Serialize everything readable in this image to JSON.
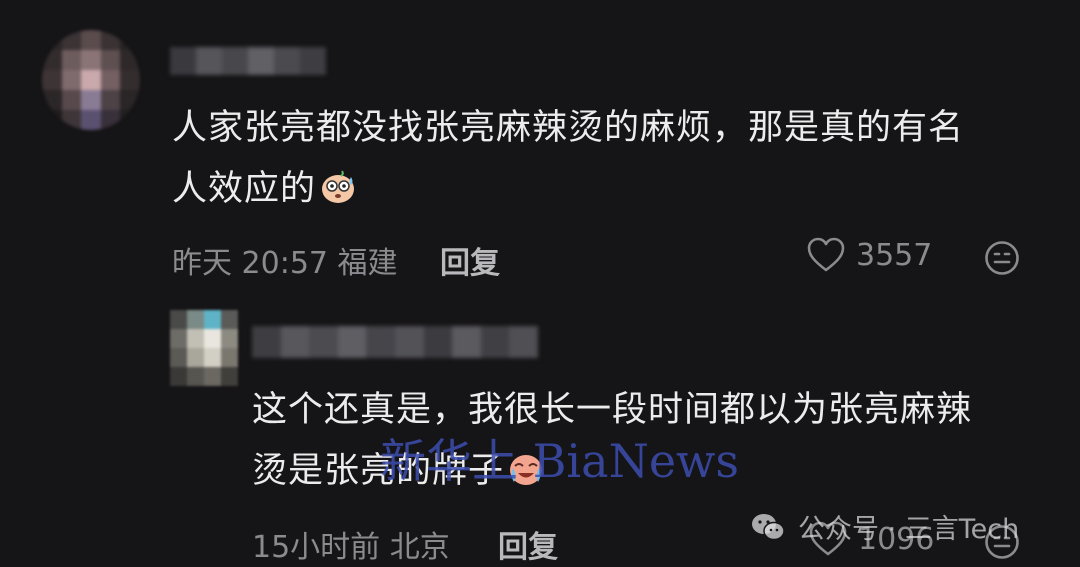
{
  "comments": [
    {
      "text_lines": [
        "人家张亮都没找张亮麻辣烫的麻烦，那是真的有名",
        "人效应的"
      ],
      "emoji": "nervous-sweat-emoji",
      "time": "昨天 20:57",
      "location": "福建",
      "reply_label": "回复",
      "likes": "3557"
    },
    {
      "text_lines": [
        "这个还真是，我很长一段时间都以为张亮麻辣",
        "烫是张亮的牌子"
      ],
      "emoji": "crying-laugh-emoji",
      "time": "15小时前",
      "location": "北京",
      "reply_label": "回复",
      "likes": "1096"
    }
  ],
  "watermarks": {
    "center": "新华上 BiaNews",
    "corner": "公众号 · 三言Tech"
  },
  "icons": {
    "like": "heart-outline-icon",
    "reaction": "emoji-reaction-icon",
    "wechat": "wechat-logo-icon"
  },
  "colors": {
    "background": "#151416",
    "text": "#ECECEC",
    "meta": "#8B8A8F",
    "watermark_blue": "#3C4EAF"
  }
}
